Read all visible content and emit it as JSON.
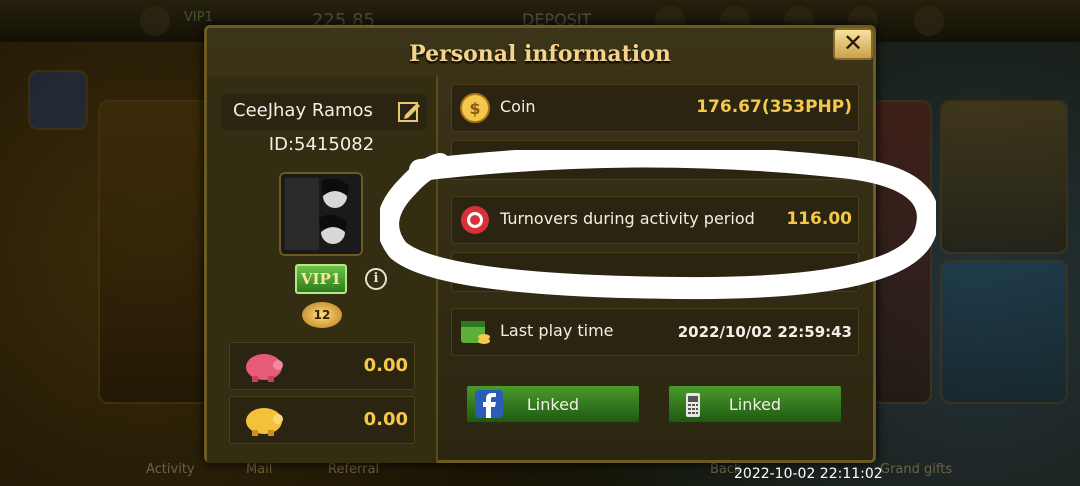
{
  "dialog": {
    "title": "Personal information",
    "close_label": "✕"
  },
  "profile": {
    "name": "CeeJhay Ramos",
    "id": "ID:5415082",
    "vip": "VIP1",
    "info_label": "i",
    "level": "12"
  },
  "bank_rows": [
    {
      "icon": "piggy-bank-icon",
      "value": "0.00"
    },
    {
      "icon": "gold-piggy-icon",
      "value": "0.00"
    }
  ],
  "info_rows": {
    "coin_label": "Coin",
    "coin_value": "176.67(353PHP)",
    "turnover_label": "Turnovers during activity period",
    "turnover_value": "116.00",
    "last_play_label": "Last play time",
    "last_play_value": "2022/10/02 22:59:43"
  },
  "buttons": {
    "facebook_label": "Linked",
    "phone_label": "Linked"
  },
  "background": {
    "deposit_label": "DEPOSIT",
    "balance": "225.85",
    "vip_label": "VIP1",
    "bottom": [
      "Activity",
      "Mail",
      "Referral",
      "Back",
      "Grand gifts"
    ]
  },
  "status_timestamp": "2022-10-02 22:11:02",
  "colors": {
    "gold": "#f5c74a",
    "title": "#f5d38a",
    "green": "#2d7a1c"
  }
}
